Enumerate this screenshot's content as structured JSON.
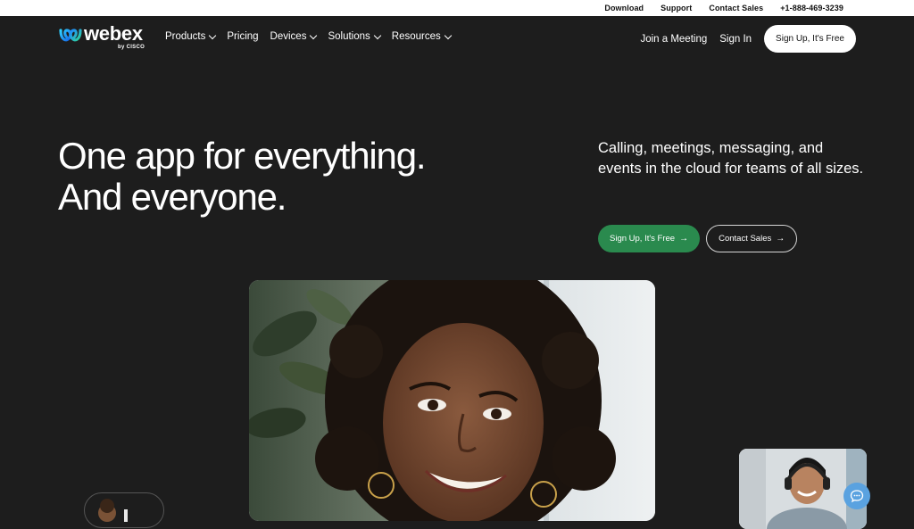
{
  "utility": {
    "download": "Download",
    "support": "Support",
    "contact_sales": "Contact Sales",
    "phone": "+1-888-469-3239"
  },
  "brand": {
    "name": "webex",
    "sub": "by CISCO"
  },
  "nav": {
    "items": [
      {
        "label": "Products",
        "dropdown": true
      },
      {
        "label": "Pricing",
        "dropdown": false
      },
      {
        "label": "Devices",
        "dropdown": true
      },
      {
        "label": "Solutions",
        "dropdown": true
      },
      {
        "label": "Resources",
        "dropdown": true
      }
    ],
    "join_meeting": "Join a Meeting",
    "sign_in": "Sign In",
    "signup": "Sign Up, It's Free"
  },
  "hero": {
    "title_line1": "One app for everything.",
    "title_line2": "And everyone.",
    "description": "Calling, meetings, messaging, and events in the cloud for teams of all sizes.",
    "cta_primary": "Sign Up, It's Free",
    "cta_secondary": "Contact Sales"
  },
  "colors": {
    "background": "#1d1d1d",
    "accent_green": "#2a8a4e",
    "chat_blue": "#5aa2e0"
  }
}
